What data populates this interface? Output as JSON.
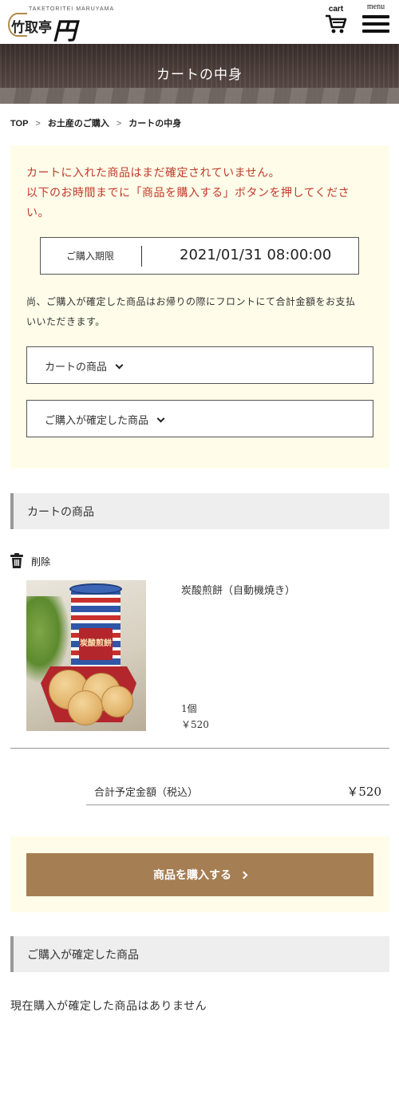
{
  "header": {
    "logo_small": "TAKETORITEI MARUYAMA",
    "logo_main": "竹取亭",
    "logo_script": "円山",
    "cart_label": "cart",
    "menu_label": "menu"
  },
  "hero": {
    "title": "カートの中身"
  },
  "breadcrumb": [
    {
      "label": "TOP"
    },
    {
      "label": "お土産のご購入"
    },
    {
      "label": "カートの中身"
    }
  ],
  "breadcrumb_sep": ">",
  "notice": {
    "warning_lines": [
      "カートに入れた商品はまだ確定されていません。",
      "以下のお時間までに「商品を購入する」ボタンを押してくださ",
      "い。"
    ],
    "deadline_label": "ご購入期限",
    "deadline_value": "2021/01/31 08:00:00",
    "info_lines": [
      "尚、ご購入が確定した商品はお帰りの際にフロントにて合計金額をお支払",
      "いいただきます。"
    ],
    "toggle_cart": "カートの商品",
    "toggle_confirmed": "ご購入が確定した商品"
  },
  "cart_section": {
    "heading": "カートの商品",
    "delete_label": "削除",
    "item": {
      "name": "炭酸煎餅（自動機焼き）",
      "quantity": "1個",
      "price": "￥520",
      "image_label": "炭酸煎餅"
    },
    "total_label": "合計予定金額（税込）",
    "total_value": "￥520"
  },
  "purchase": {
    "button_label": "商品を購入する"
  },
  "confirmed_section": {
    "heading": "ご購入が確定した商品",
    "empty_text": "現在購入が確定した商品はありません"
  },
  "colors": {
    "accent_button": "#a67e53",
    "notice_bg": "#fffde9",
    "warning_text": "#c0392b",
    "section_bg": "#eeeeee"
  }
}
